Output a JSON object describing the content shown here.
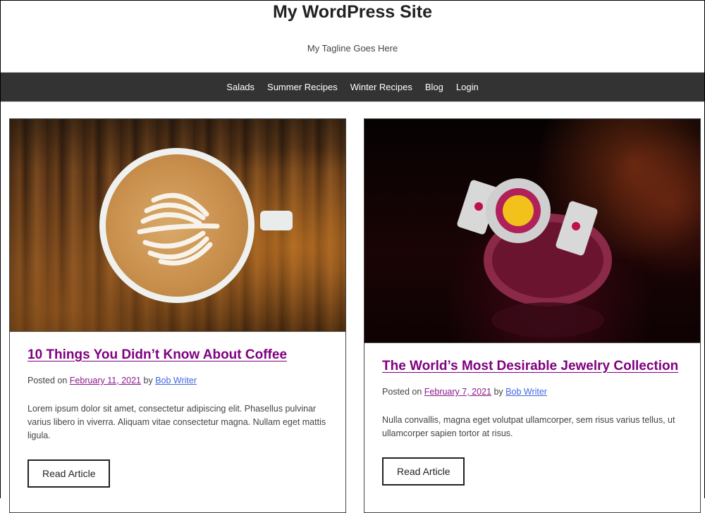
{
  "header": {
    "site_title": "My WordPress Site",
    "tagline": "My Tagline Goes Here"
  },
  "nav": {
    "items": [
      {
        "label": "Salads"
      },
      {
        "label": "Summer Recipes"
      },
      {
        "label": "Winter Recipes"
      },
      {
        "label": "Blog"
      },
      {
        "label": "Login"
      }
    ]
  },
  "posts": [
    {
      "title": "10 Things You Didn’t Know About Coffee",
      "image": "coffee-latte-art-photo",
      "posted_on_label": "Posted on",
      "date": "February 11, 2021",
      "by_label": "by",
      "author": "Bob Writer",
      "excerpt": "Lorem ipsum dolor sit amet, consectetur adipiscing elit. Phasellus pulvinar varius libero in viverra. Aliquam vitae consectetur magna. Nullam eget mattis ligula.",
      "button_label": "Read Article"
    },
    {
      "title": "The World’s Most Desirable Jewelry Collection",
      "image": "jeweled-bracelet-photo",
      "posted_on_label": "Posted on",
      "date": "February 7, 2021",
      "by_label": "by",
      "author": "Bob Writer",
      "excerpt": "Nulla convallis, magna eget volutpat ullamcorper, sem risus varius tellus, ut ullamcorper sapien tortor at risus.",
      "button_label": "Read Article"
    }
  ],
  "colors": {
    "nav_bg": "#333333",
    "title_link": "#800080",
    "date_link": "#8b1a8b",
    "author_link": "#4169e1"
  }
}
